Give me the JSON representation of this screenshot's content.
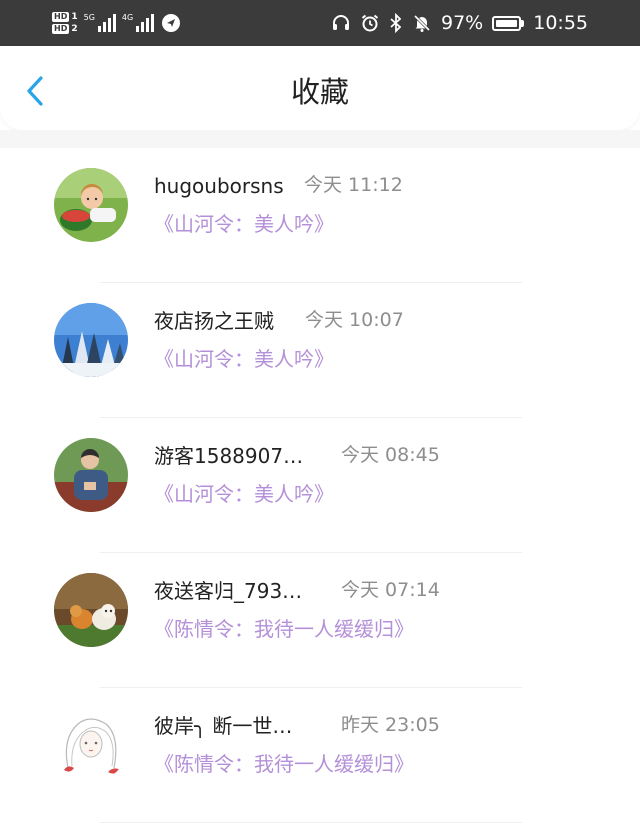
{
  "status_bar": {
    "hd1": "HD",
    "hd1_num": "1",
    "hd2": "HD",
    "hd2_num": "2",
    "net1": "5G",
    "net2": "4G",
    "battery": "97%",
    "time": "10:55"
  },
  "header": {
    "title": "收藏"
  },
  "items": [
    {
      "name": "hugouborsns",
      "time": "今天 11:12",
      "drama": "《山河令：美人吟》"
    },
    {
      "name": "夜店扬之王贼",
      "time": "今天 10:07",
      "drama": "《山河令：美人吟》"
    },
    {
      "name": "游客1588907…",
      "time": "今天 08:45",
      "drama": "《山河令：美人吟》"
    },
    {
      "name": "夜送客归_793…",
      "time": "今天 07:14",
      "drama": "《陈情令：我待一人缓缓归》"
    },
    {
      "name": "彼岸╮ 断一世…",
      "time": "昨天 23:05",
      "drama": "《陈情令：我待一人缓缓归》"
    }
  ],
  "colors": {
    "accent": "#2aa4e8",
    "drama_text": "#b490d8",
    "status_bar_bg": "#3b3b3b"
  }
}
